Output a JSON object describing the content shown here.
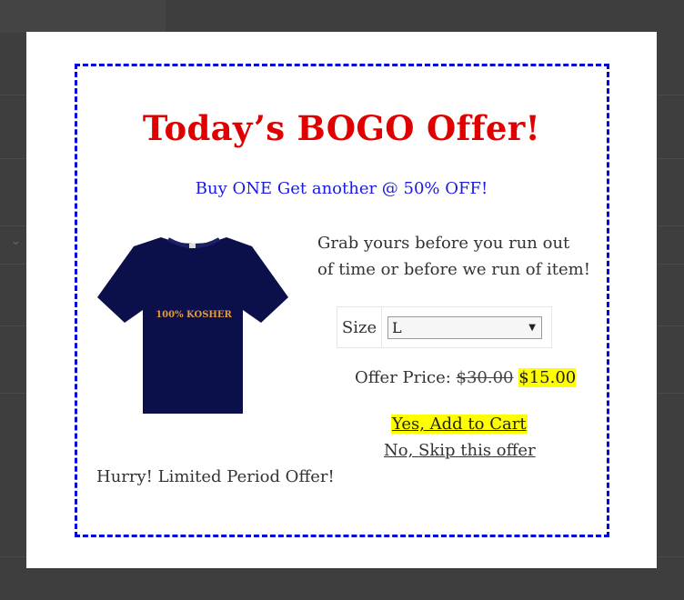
{
  "popup": {
    "title": "Today’s BOGO Offer!",
    "subtitle": "Buy ONE Get another @ 50% OFF!",
    "description": "Grab yours before you run out of time or before we run of item!",
    "product_image": {
      "alt": "Navy t-shirt",
      "print_text": "100% KOSHER",
      "shirt_color": "#0b0f4a",
      "print_color": "#e39a3d"
    },
    "size": {
      "label": "Size",
      "selected": "L"
    },
    "price": {
      "label": "Offer Price:",
      "original": "$30.00",
      "offer": "$15.00"
    },
    "accept_label": "Yes, Add to Cart",
    "decline_label": "No, Skip this offer",
    "urgency": "Hurry! Limited Period Offer!"
  },
  "colors": {
    "title": "#e00000",
    "subtitle": "#1a1ae6",
    "border": "#0000dd",
    "highlight": "#ffff00",
    "overlay": "#3e3e3e"
  }
}
